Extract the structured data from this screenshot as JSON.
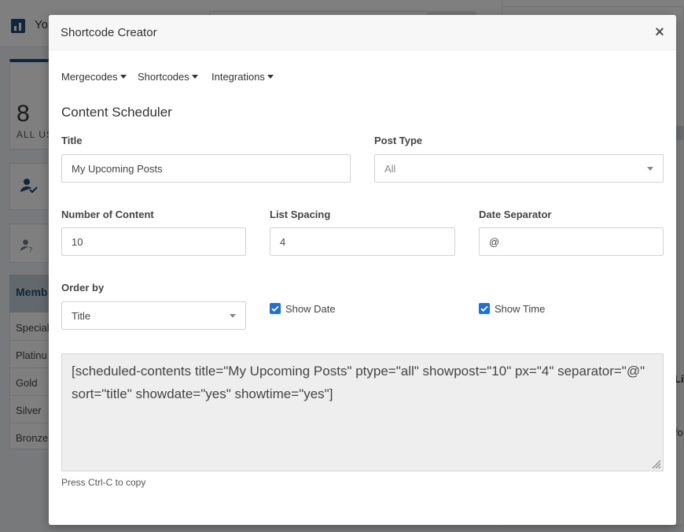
{
  "background": {
    "brand": "Yo",
    "stat_number": "8",
    "stat_label": "ALL US",
    "members_title": "Memb",
    "members": [
      "Special",
      "Platinu",
      "Gold",
      "Silver",
      "Bronze"
    ],
    "right_text_1": "Li",
    "right_text_2": "fo"
  },
  "modal": {
    "title": "Shortcode Creator",
    "close_glyph": "×",
    "menus": [
      {
        "label": "Mergecodes"
      },
      {
        "label": "Shortcodes"
      },
      {
        "label": "Integrations"
      }
    ],
    "section_title": "Content Scheduler",
    "fields": {
      "title": {
        "label": "Title",
        "value": "My Upcoming Posts"
      },
      "post_type": {
        "label": "Post Type",
        "value": "All"
      },
      "number_of_content": {
        "label": "Number of Content",
        "value": "10"
      },
      "list_spacing": {
        "label": "List Spacing",
        "value": "4"
      },
      "date_separator": {
        "label": "Date Separator",
        "value": "@"
      },
      "order_by": {
        "label": "Order by",
        "value": "Title"
      },
      "show_date": {
        "label": "Show Date",
        "checked": true
      },
      "show_time": {
        "label": "Show Time",
        "checked": true
      }
    },
    "shortcode_output": "[scheduled-contents title=\"My Upcoming Posts\" ptype=\"all\" showpost=\"10\" px=\"4\" separator=\"@\" sort=\"title\" showdate=\"yes\" showtime=\"yes\"]",
    "copy_hint": "Press Ctrl-C to copy"
  },
  "colors": {
    "accent": "#1e6fd9",
    "brand": "#1f4e79",
    "overlay": "rgba(0,0,0,0.5)"
  },
  "icons": [
    "bar-chart-icon",
    "user-check-icon",
    "user-question-icon",
    "close-icon",
    "caret-down-icon",
    "checkbox-checked-icon",
    "resize-grip-icon"
  ]
}
